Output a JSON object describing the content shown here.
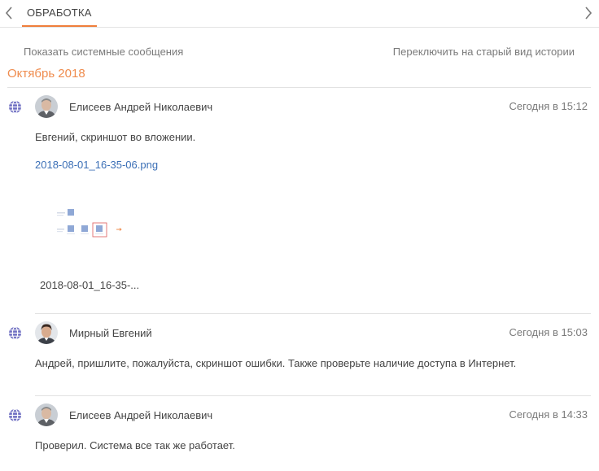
{
  "tab": {
    "label": "ОБРАБОТКА"
  },
  "actions": {
    "show_system": "Показать системные сообщения",
    "switch_view": "Переключить на старый вид истории"
  },
  "month": "Октябрь 2018",
  "entries": [
    {
      "author": "Елисеев Андрей Николаевич",
      "date": "Сегодня в 15:12",
      "message": "Евгений, скриншот во вложении.",
      "file_link": "2018-08-01_16-35-06.png",
      "thumb_caption": "2018-08-01_16-35-..."
    },
    {
      "author": "Мирный Евгений",
      "date": "Сегодня в 15:03",
      "message": "Андрей, пришлите, пожалуйста, скриншот ошибки. Также проверьте наличие доступа в Интернет."
    },
    {
      "author": "Елисеев Андрей Николаевич",
      "date": "Сегодня в 14:33",
      "message": "Проверил. Система все так же работает."
    }
  ],
  "colors": {
    "accent": "#ef7e3b",
    "link": "#3b6fb6",
    "globe": "#6f6fc2"
  },
  "icons": {
    "globe": "globe-icon",
    "left": "chevron-left-icon",
    "right": "chevron-right-icon"
  }
}
